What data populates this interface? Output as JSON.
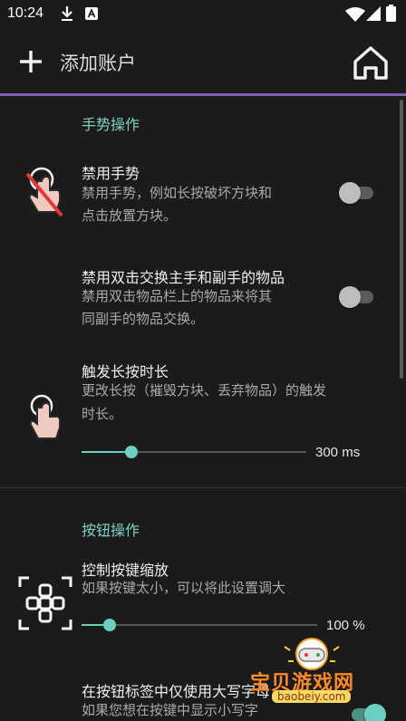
{
  "status_bar": {
    "time": "10:24",
    "icons": [
      "download-icon",
      "a-notification-icon",
      "wifi-icon",
      "cellular-signal-icon",
      "battery-icon"
    ]
  },
  "app_bar": {
    "add_icon": "plus-icon",
    "title": "添加账户",
    "home_icon": "home-icon",
    "accent_color": "#8c5bb8"
  },
  "sections": {
    "gesture": {
      "title": "手势操作",
      "disable_gestures": {
        "title": "禁用手势",
        "desc_line1": "禁用手势，例如长按破坏方块和",
        "desc_line2": "点击放置方块。",
        "enabled": false,
        "icon": "disabled-gesture-icon"
      },
      "disable_double_tap": {
        "title": "禁用双击交换主手和副手的物品",
        "desc_line1": "禁用双击物品栏上的物品来将其",
        "desc_line2": "同副手的物品交换。",
        "enabled": false
      },
      "long_press": {
        "title": "触发长按时长",
        "desc_line1": "更改长按（摧毁方块、丢弃物品）的触发",
        "desc_line2": "时长。",
        "icon": "touch-gesture-icon",
        "value_fraction": 0.22,
        "value_label": "300 ms"
      }
    },
    "buttons": {
      "title": "按钮操作",
      "button_scale": {
        "title": "控制按键缩放",
        "desc": "如果按键太小，可以将此设置调大",
        "icon": "button-layout-icon",
        "value_fraction": 0.12,
        "value_label": "100 %"
      },
      "uppercase_only": {
        "title": "在按钮标签中仅使用大写字母",
        "desc": "如果您想在按键中显示小写字",
        "enabled": true
      }
    }
  },
  "watermark": {
    "text": "宝贝游戏网",
    "url": "baobeiy.com"
  },
  "colors": {
    "background": "#1b1b1b",
    "section_title": "#7fd1c3",
    "toggle_on": "#6bd0c1",
    "toggle_off": "#bdbdbd"
  }
}
